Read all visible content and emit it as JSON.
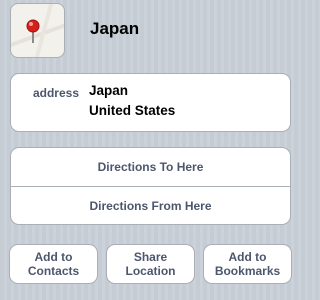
{
  "header": {
    "title": "Japan",
    "pin_icon": "map-pin-icon",
    "pin_color": "#d8201b"
  },
  "address": {
    "label": "address",
    "lines": [
      "Japan",
      "United States"
    ]
  },
  "directions": {
    "to_label": "Directions To Here",
    "from_label": "Directions From Here"
  },
  "actions": {
    "add_contacts": [
      "Add to",
      "Contacts"
    ],
    "share_location": [
      "Share",
      "Location"
    ],
    "add_bookmarks": [
      "Add to",
      "Bookmarks"
    ]
  },
  "colors": {
    "background": "#c5ccd4",
    "label_text": "#4c566c",
    "border": "#a9afb6"
  }
}
